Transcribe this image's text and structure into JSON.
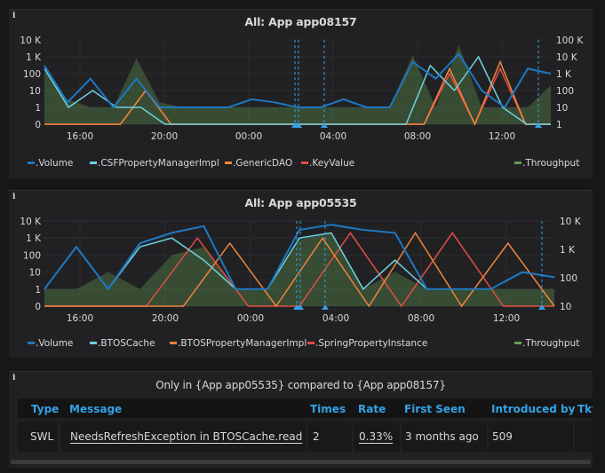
{
  "panels": [
    {
      "title": "All: App app08157",
      "legend": [
        ".Volume",
        ".CSFPropertyManagerImpl",
        ".GenericDAO",
        ".KeyValue",
        ".Throughput"
      ]
    },
    {
      "title": "All: App app05535",
      "legend": [
        ".Volume",
        ".BTOSCache",
        ".BTOSPropertyManagerImpl",
        ".SpringPropertyInstance",
        ".Throughput"
      ]
    }
  ],
  "colors": {
    "volume": "#1f78c1",
    "series2": "#6ed0e0",
    "series3": "#ef843c",
    "series4": "#e24d42",
    "throughput": "#629e51",
    "annotation": "#33a2e5"
  },
  "chart_data": [
    {
      "type": "line",
      "title": "All: App app08157",
      "y_left_ticks": [
        "10 K",
        "1 K",
        "100",
        "10",
        "1",
        "0"
      ],
      "y_right_ticks": [
        "100 K",
        "10 K",
        "1 K",
        "100",
        "10",
        "1"
      ],
      "x_ticks": [
        "16:00",
        "20:00",
        "00:00",
        "04:00",
        "08:00",
        "12:00"
      ],
      "y_scale": "log",
      "annotations_count": 4,
      "series": [
        {
          "name": ".Volume",
          "values": [
            300,
            2,
            50,
            1,
            50,
            1,
            1,
            1,
            1,
            3,
            2,
            1,
            1,
            3,
            1,
            1,
            500,
            50,
            1500,
            10,
            1,
            200,
            100
          ]
        },
        {
          "name": ".CSFPropertyManagerImpl",
          "values": [
            200,
            1,
            10,
            1,
            1,
            0,
            0,
            0,
            0,
            0,
            0,
            0,
            0,
            0,
            0,
            0,
            300,
            10,
            1000,
            1,
            0,
            0
          ]
        },
        {
          "name": ".GenericDAO",
          "values": [
            0,
            0,
            0,
            0,
            10,
            0,
            0,
            0,
            0,
            0,
            0,
            0,
            0,
            0,
            0,
            0,
            200,
            0,
            500,
            0,
            0
          ]
        },
        {
          "name": ".KeyValue",
          "values": [
            0,
            0,
            0,
            0,
            10,
            0,
            0,
            0,
            0,
            0,
            0,
            0,
            0,
            0,
            0,
            0,
            100,
            0,
            200,
            0,
            0
          ]
        },
        {
          "name": ".Throughput",
          "values": [
            150,
            3,
            1,
            1,
            800,
            2,
            1,
            1,
            1,
            1,
            1,
            1,
            1,
            1,
            1,
            1,
            1200,
            1,
            5000,
            1,
            1,
            1,
            20
          ]
        }
      ]
    },
    {
      "type": "line",
      "title": "All: App app05535",
      "y_left_ticks": [
        "10 K",
        "1 K",
        "100",
        "10",
        "1",
        "0"
      ],
      "y_right_ticks": [
        "10 K",
        "1 K",
        "100",
        "10"
      ],
      "x_ticks": [
        "16:00",
        "20:00",
        "00:00",
        "04:00",
        "08:00",
        "12:00"
      ],
      "y_scale": "log",
      "annotations_count": 3,
      "series": [
        {
          "name": ".Volume",
          "values": [
            1,
            300,
            1,
            500,
            2000,
            5000,
            1,
            1,
            3000,
            6000,
            3000,
            2000,
            1,
            1,
            1,
            10,
            5
          ]
        },
        {
          "name": ".BTOSCache",
          "values": [
            1,
            300,
            1,
            300,
            1000,
            50,
            1,
            1,
            1000,
            2000,
            1,
            50,
            1,
            1,
            1,
            10,
            5
          ]
        },
        {
          "name": ".BTOSPropertyManagerImpl",
          "values": [
            0,
            0,
            0,
            0,
            500,
            0,
            1000,
            0,
            2000,
            0,
            500,
            0
          ]
        },
        {
          "name": ".SpringPropertyInstance",
          "values": [
            0,
            0,
            0,
            1000,
            0,
            0,
            2000,
            0,
            2000,
            0,
            0
          ]
        },
        {
          "name": ".Throughput",
          "values": [
            1,
            1,
            10,
            1,
            100,
            300,
            1,
            1,
            800,
            2000,
            1,
            10,
            1,
            1,
            1,
            1,
            1
          ]
        }
      ]
    }
  ],
  "table_panel": {
    "title": "Only in {App app05535} compared to {App app08157}",
    "columns": [
      "Type",
      "Message",
      "Times",
      "Rate",
      "First Seen",
      "Introduced by",
      "Tkt"
    ],
    "rows": [
      {
        "type": "SWL",
        "message": "NeedsRefreshException in BTOSCache.read",
        "times": "2",
        "rate": "0.33%",
        "first_seen": "3 months ago",
        "introduced_by": "509",
        "tkt": ""
      }
    ]
  }
}
